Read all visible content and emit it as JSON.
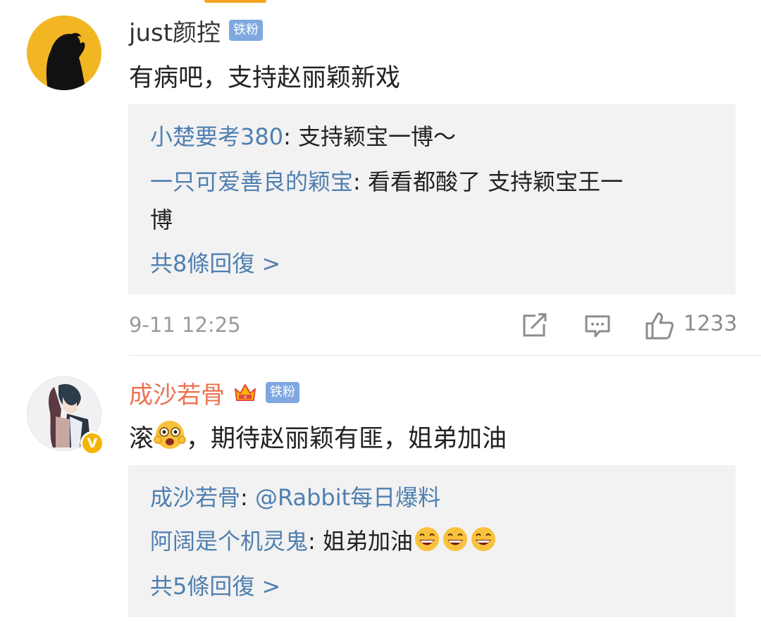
{
  "comments": [
    {
      "username": "just颜控",
      "badge": "铁粉",
      "text": "有病吧，支持赵丽颖新戏",
      "replies": [
        {
          "user": "小楚要考380",
          "text": "支持颖宝一博～"
        },
        {
          "user": "一只可爱善良的颖宝",
          "text": "看看都酸了  支持颖宝王一",
          "text_cont": "博"
        }
      ],
      "more_replies": "共8條回復 >",
      "time": "9-11 12:25",
      "likes": "1233"
    },
    {
      "username": "成沙若骨",
      "badge": "铁粉",
      "verified": "V",
      "text_before_emoji": "滚",
      "text_after_emoji": "，期待赵丽颖有匪，姐弟加油",
      "replies": [
        {
          "user": "成沙若骨",
          "text": "@Rabbit每日爆料"
        },
        {
          "user": "阿阔是个机灵鬼",
          "text": "姐弟加油"
        }
      ],
      "more_replies": "共5條回復 >"
    }
  ],
  "colors": {
    "link_blue": "#4f7fb0",
    "vip_orange": "#eb7350",
    "badge_blue": "#7fa8e0",
    "reply_bg": "#f2f2f2",
    "avatar_yellow": "#f2b622"
  },
  "icons": [
    "repost-icon",
    "comment-icon",
    "like-icon",
    "crown-icon",
    "silhouette-avatar",
    "anime-avatar",
    "grin-emoji",
    "laugh-emoji"
  ]
}
